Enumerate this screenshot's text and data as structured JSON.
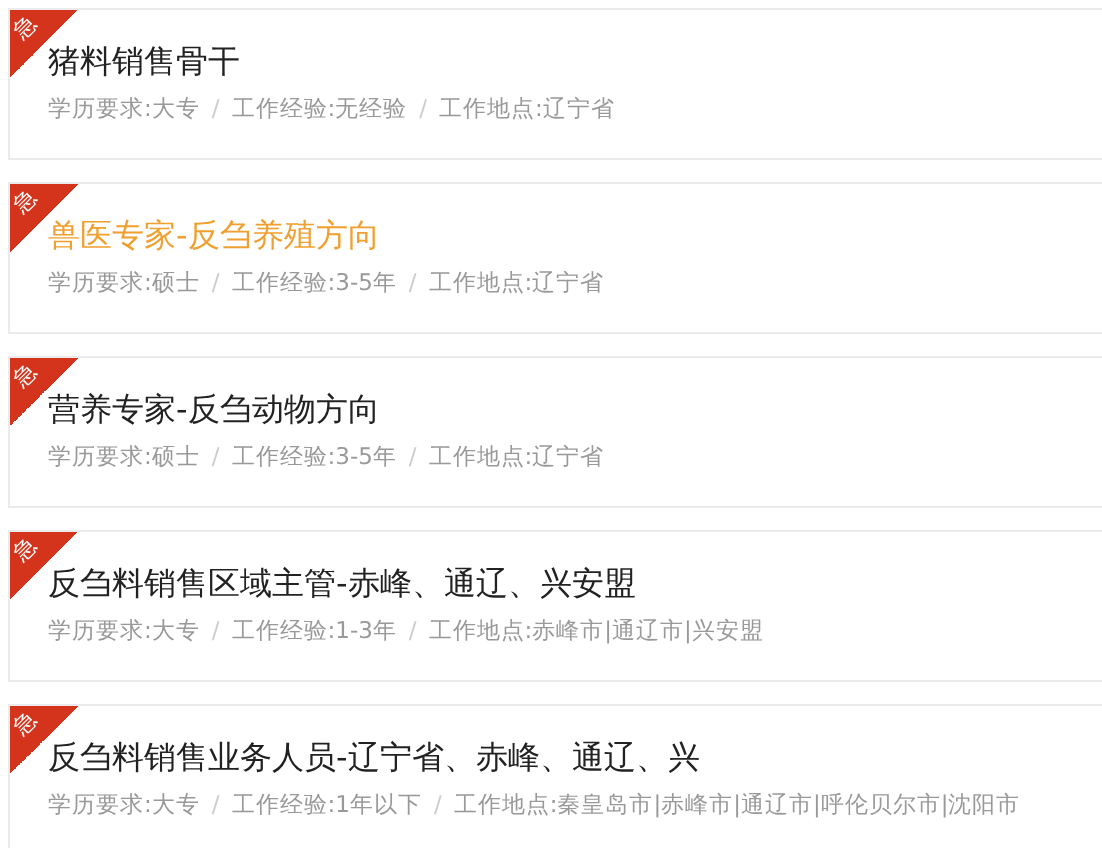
{
  "jobs": [
    {
      "badge": "急",
      "title": "猪料销售骨干",
      "selected": false,
      "meta": [
        "学历要求:大专",
        "/",
        "工作经验:无经验",
        "/",
        "工作地点:辽宁省"
      ]
    },
    {
      "badge": "急",
      "title": "兽医专家-反刍养殖方向",
      "selected": true,
      "meta": [
        "学历要求:硕士",
        "/",
        "工作经验:3-5年",
        "/",
        "工作地点:辽宁省"
      ]
    },
    {
      "badge": "急",
      "title": "营养专家-反刍动物方向",
      "selected": false,
      "meta": [
        "学历要求:硕士",
        "/",
        "工作经验:3-5年",
        "/",
        "工作地点:辽宁省"
      ]
    },
    {
      "badge": "急",
      "title": "反刍料销售区域主管-赤峰、通辽、兴安盟",
      "selected": false,
      "meta": [
        "学历要求:大专",
        "/",
        "工作经验:1-3年",
        "/",
        "工作地点:赤峰市|通辽市|兴安盟"
      ]
    },
    {
      "badge": "急",
      "title": "反刍料销售业务人员-辽宁省、赤峰、通辽、兴",
      "selected": false,
      "meta": [
        "学历要求:大专",
        "/",
        "工作经验:1年以下",
        "/",
        "工作地点:秦皇岛市|赤峰市|通辽市|呼伦贝尔市|沈阳市"
      ]
    }
  ]
}
